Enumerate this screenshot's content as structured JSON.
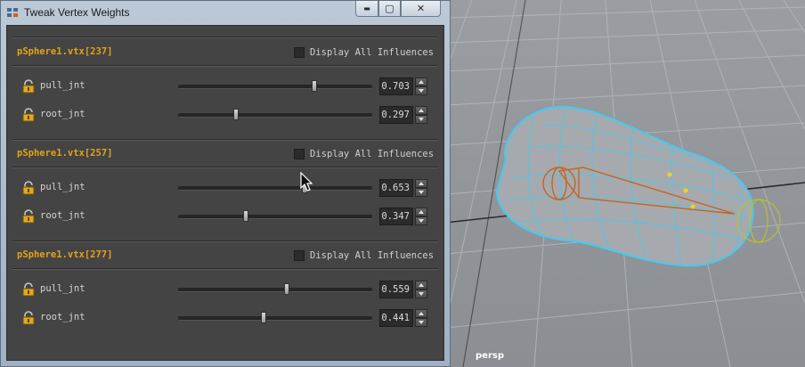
{
  "window": {
    "title": "Tweak Vertex Weights",
    "minimize_glyph": "▬",
    "maximize_glyph": "▢",
    "close_glyph": "✕"
  },
  "vertices": [
    {
      "label": "pSphere1.vtx[237]",
      "display_all_label": "Display All Influences",
      "display_all_checked": false,
      "joints": [
        {
          "name": "pull_jnt",
          "value": "0.703",
          "weight": 0.703,
          "locked": true
        },
        {
          "name": "root_jnt",
          "value": "0.297",
          "weight": 0.297,
          "locked": true
        }
      ]
    },
    {
      "label": "pSphere1.vtx[257]",
      "display_all_label": "Display All Influences",
      "display_all_checked": false,
      "joints": [
        {
          "name": "pull_jnt",
          "value": "0.653",
          "weight": 0.653,
          "locked": true
        },
        {
          "name": "root_jnt",
          "value": "0.347",
          "weight": 0.347,
          "locked": true
        }
      ]
    },
    {
      "label": "pSphere1.vtx[277]",
      "display_all_label": "Display All Influences",
      "display_all_checked": false,
      "joints": [
        {
          "name": "pull_jnt",
          "value": "0.559",
          "weight": 0.559,
          "locked": true
        },
        {
          "name": "root_jnt",
          "value": "0.441",
          "weight": 0.441,
          "locked": true
        }
      ]
    }
  ],
  "viewport": {
    "camera_label": "persp"
  },
  "colors": {
    "accent": "#e3a21a",
    "panel_bg": "#444444",
    "mesh_wire": "#49c8ee",
    "joint": "#c8641e"
  },
  "icons": {
    "lock": "lock-icon",
    "window": "maya-window-icon",
    "cursor": "mouse-pointer-icon"
  }
}
